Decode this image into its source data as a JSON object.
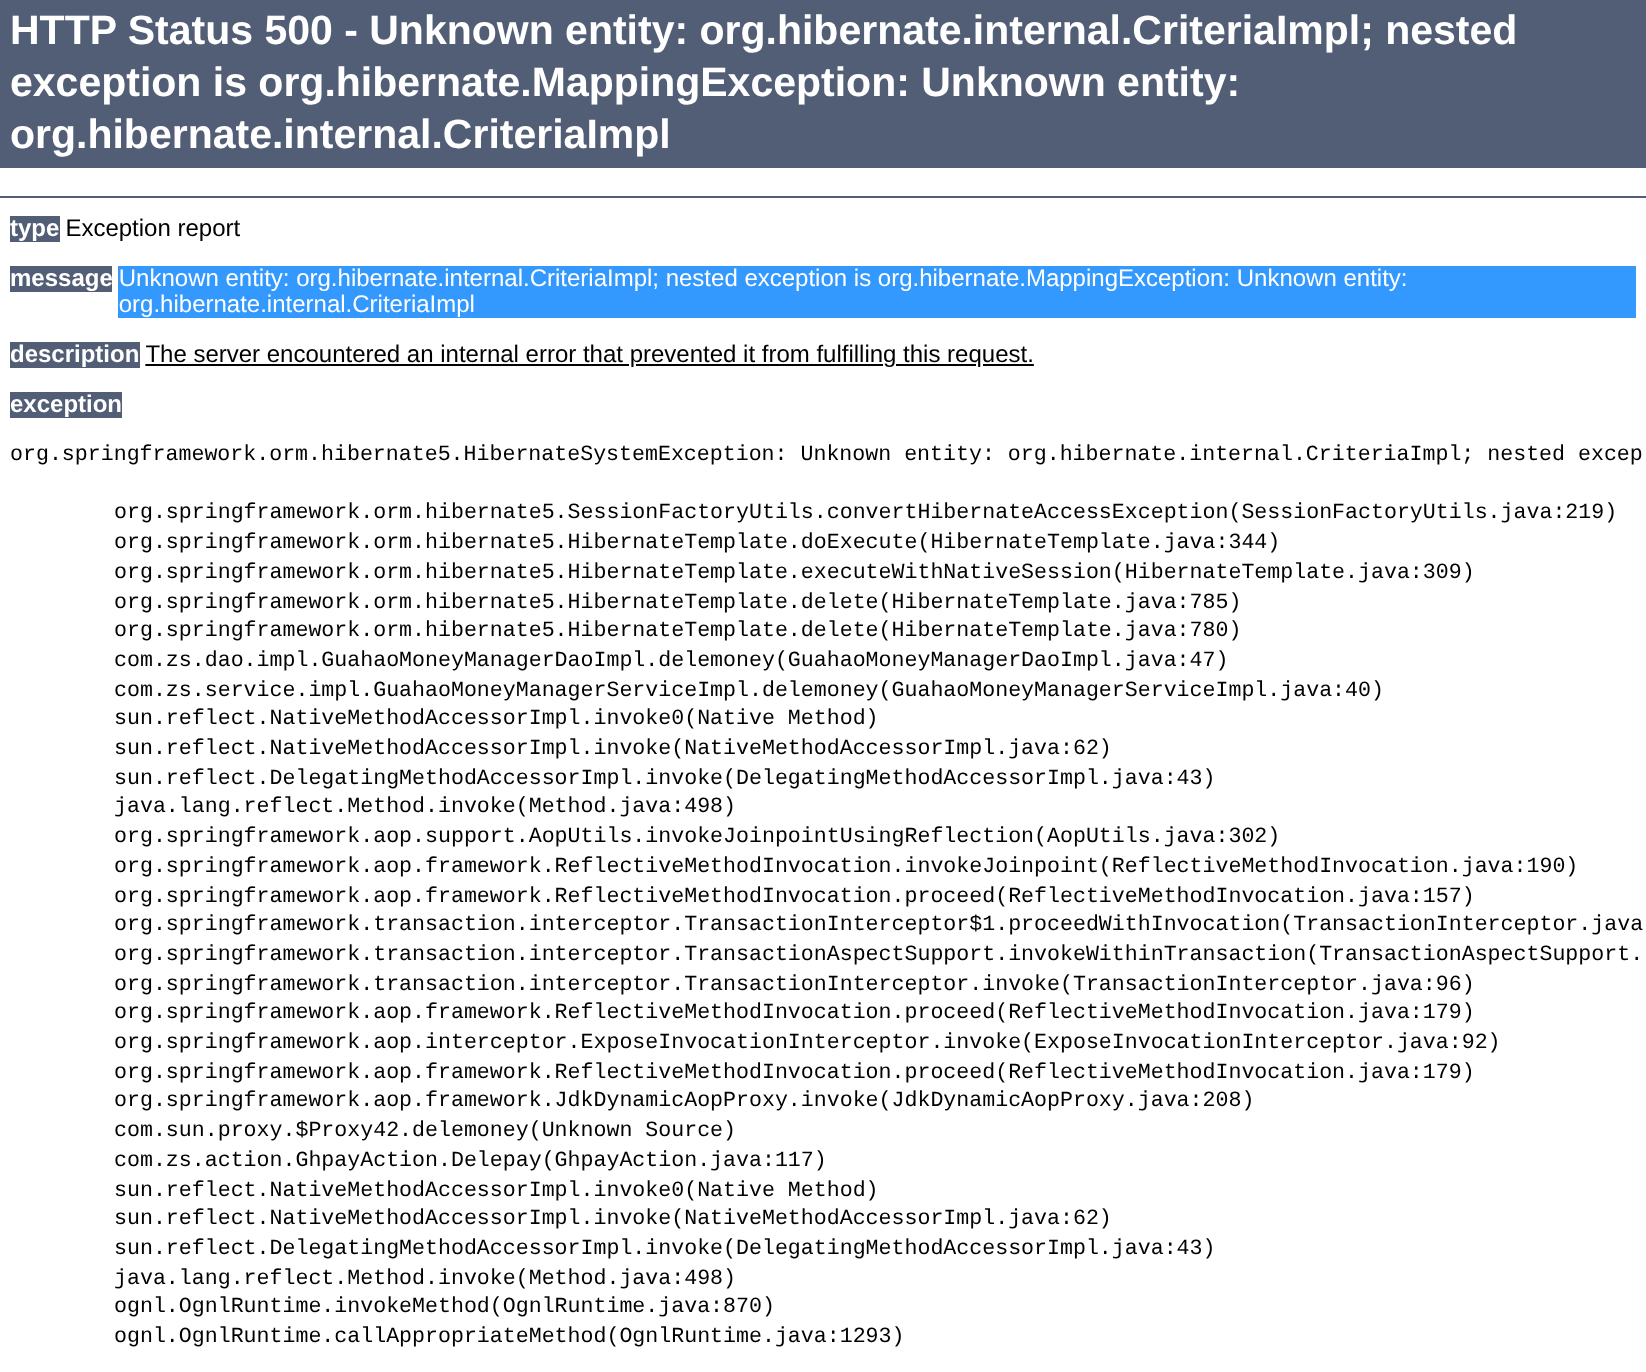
{
  "title": "HTTP Status 500 - Unknown entity: org.hibernate.internal.CriteriaImpl; nested exception is org.hibernate.MappingException: Unknown entity: org.hibernate.internal.CriteriaImpl",
  "type": {
    "label": "type",
    "text": "Exception report"
  },
  "message": {
    "label": "message",
    "text": "Unknown entity: org.hibernate.internal.CriteriaImpl; nested exception is org.hibernate.MappingException: Unknown entity: org.hibernate.internal.CriteriaImpl",
    "selected": true
  },
  "description": {
    "label": "description",
    "text": "The server encountered an internal error that prevented it from fulfilling this request."
  },
  "exception": {
    "label": "exception",
    "summary": "org.springframework.orm.hibernate5.HibernateSystemException: Unknown entity: org.hibernate.internal.CriteriaImpl; nested excep",
    "frames": [
      "org.springframework.orm.hibernate5.SessionFactoryUtils.convertHibernateAccessException(SessionFactoryUtils.java:219)",
      "org.springframework.orm.hibernate5.HibernateTemplate.doExecute(HibernateTemplate.java:344)",
      "org.springframework.orm.hibernate5.HibernateTemplate.executeWithNativeSession(HibernateTemplate.java:309)",
      "org.springframework.orm.hibernate5.HibernateTemplate.delete(HibernateTemplate.java:785)",
      "org.springframework.orm.hibernate5.HibernateTemplate.delete(HibernateTemplate.java:780)",
      "com.zs.dao.impl.GuahaoMoneyManagerDaoImpl.delemoney(GuahaoMoneyManagerDaoImpl.java:47)",
      "com.zs.service.impl.GuahaoMoneyManagerServiceImpl.delemoney(GuahaoMoneyManagerServiceImpl.java:40)",
      "sun.reflect.NativeMethodAccessorImpl.invoke0(Native Method)",
      "sun.reflect.NativeMethodAccessorImpl.invoke(NativeMethodAccessorImpl.java:62)",
      "sun.reflect.DelegatingMethodAccessorImpl.invoke(DelegatingMethodAccessorImpl.java:43)",
      "java.lang.reflect.Method.invoke(Method.java:498)",
      "org.springframework.aop.support.AopUtils.invokeJoinpointUsingReflection(AopUtils.java:302)",
      "org.springframework.aop.framework.ReflectiveMethodInvocation.invokeJoinpoint(ReflectiveMethodInvocation.java:190)",
      "org.springframework.aop.framework.ReflectiveMethodInvocation.proceed(ReflectiveMethodInvocation.java:157)",
      "org.springframework.transaction.interceptor.TransactionInterceptor$1.proceedWithInvocation(TransactionInterceptor.java",
      "org.springframework.transaction.interceptor.TransactionAspectSupport.invokeWithinTransaction(TransactionAspectSupport.",
      "org.springframework.transaction.interceptor.TransactionInterceptor.invoke(TransactionInterceptor.java:96)",
      "org.springframework.aop.framework.ReflectiveMethodInvocation.proceed(ReflectiveMethodInvocation.java:179)",
      "org.springframework.aop.interceptor.ExposeInvocationInterceptor.invoke(ExposeInvocationInterceptor.java:92)",
      "org.springframework.aop.framework.ReflectiveMethodInvocation.proceed(ReflectiveMethodInvocation.java:179)",
      "org.springframework.aop.framework.JdkDynamicAopProxy.invoke(JdkDynamicAopProxy.java:208)",
      "com.sun.proxy.$Proxy42.delemoney(Unknown Source)",
      "com.zs.action.GhpayAction.Delepay(GhpayAction.java:117)",
      "sun.reflect.NativeMethodAccessorImpl.invoke0(Native Method)",
      "sun.reflect.NativeMethodAccessorImpl.invoke(NativeMethodAccessorImpl.java:62)",
      "sun.reflect.DelegatingMethodAccessorImpl.invoke(DelegatingMethodAccessorImpl.java:43)",
      "java.lang.reflect.Method.invoke(Method.java:498)",
      "ognl.OgnlRuntime.invokeMethod(OgnlRuntime.java:870)",
      "ognl.OgnlRuntime.callAppropriateMethod(OgnlRuntime.java:1293)"
    ]
  }
}
